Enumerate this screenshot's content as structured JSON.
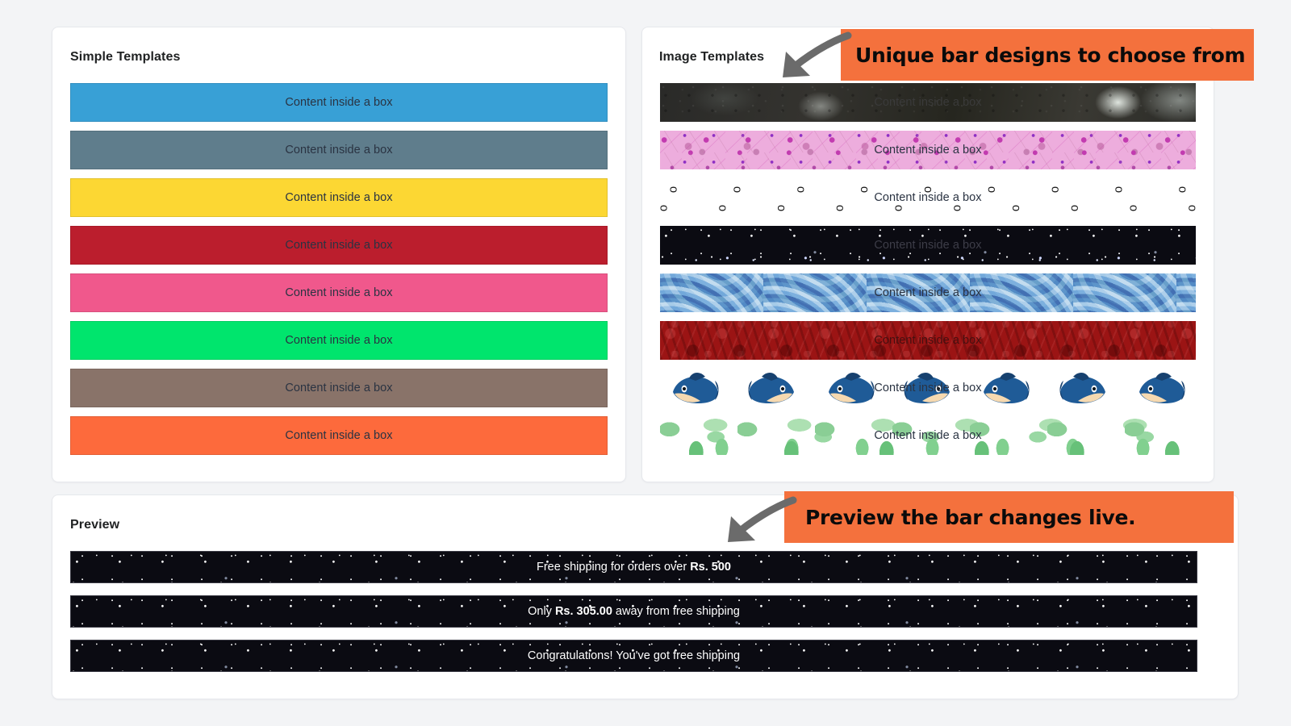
{
  "page": {
    "background_color": "#f3f4f6",
    "accent_color": "#f4713d"
  },
  "simple_templates": {
    "title": "Simple Templates",
    "bars": [
      {
        "name": "blue",
        "color": "#38a0d6",
        "label": "Content inside a box"
      },
      {
        "name": "slate",
        "color": "#5f7d8c",
        "label": "Content inside a box"
      },
      {
        "name": "yellow",
        "color": "#fcd733",
        "label": "Content inside a box"
      },
      {
        "name": "crimson",
        "color": "#bb1e2d",
        "label": "Content inside a box"
      },
      {
        "name": "pink",
        "color": "#f0588c",
        "label": "Content inside a box"
      },
      {
        "name": "spring-green",
        "color": "#00e56d",
        "label": "Content inside a box"
      },
      {
        "name": "taupe",
        "color": "#897369",
        "label": "Content inside a box"
      },
      {
        "name": "orange",
        "color": "#fd6a3c",
        "label": "Content inside a box"
      }
    ]
  },
  "image_templates": {
    "title": "Image Templates",
    "bars": [
      {
        "name": "dark-blur-photo",
        "label": "Content inside a box",
        "text_color": "#3a3a3a"
      },
      {
        "name": "pink-floral",
        "label": "Content inside a box",
        "text_color": "#2a3342"
      },
      {
        "name": "headphones-white",
        "label": "Content inside a box",
        "text_color": "#2a3342"
      },
      {
        "name": "starfield",
        "label": "Content inside a box",
        "text_color": "#3d3d48"
      },
      {
        "name": "blue-swirl",
        "label": "Content inside a box",
        "text_color": "#2a3342"
      },
      {
        "name": "red-damask",
        "label": "Content inside a box",
        "text_color": "#451010"
      },
      {
        "name": "sharks-white",
        "label": "Content inside a box",
        "text_color": "#2a3342"
      },
      {
        "name": "green-leaves",
        "label": "Content inside a box",
        "text_color": "#2a3342"
      }
    ]
  },
  "preview": {
    "title": "Preview",
    "bars": [
      {
        "name": "free-shipping-threshold",
        "prefix": "Free shipping for orders over ",
        "strong": "Rs. 500",
        "suffix": ""
      },
      {
        "name": "amount-away",
        "prefix": "Only ",
        "strong": "Rs. 305.00",
        "suffix": " away from free shipping"
      },
      {
        "name": "congratulations",
        "prefix": "Congratulations! You've got free shipping",
        "strong": "",
        "suffix": ""
      }
    ]
  },
  "annotations": [
    {
      "name": "unique-bar-designs",
      "text": "Unique bar designs to choose from"
    },
    {
      "name": "preview-live",
      "text": "Preview the bar changes live."
    }
  ],
  "icons": {
    "headphone": "ᴑ",
    "arrow": "curved-arrow-icon"
  }
}
